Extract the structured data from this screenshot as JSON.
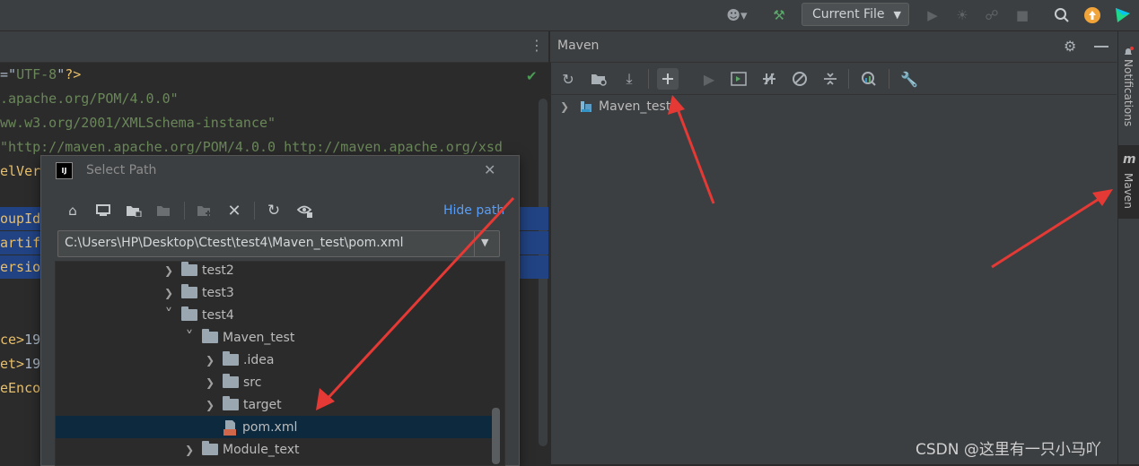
{
  "topbar": {
    "run_config": "Current File",
    "icons": [
      "user-icon",
      "hammer-icon",
      "run-icon",
      "debug-icon",
      "coverage-icon",
      "stop-icon",
      "search-icon",
      "update-icon",
      "jetbrains-logo-icon"
    ]
  },
  "editor": {
    "lines": [
      {
        "parts": [
          {
            "c": "w",
            "t": "=\""
          },
          {
            "c": "s",
            "t": "UTF-8"
          },
          {
            "c": "w",
            "t": "\""
          },
          {
            "c": "t",
            "t": "?>"
          }
        ]
      },
      {
        "parts": [
          {
            "c": "s",
            "t": ".apache.org/POM/4.0.0\""
          }
        ]
      },
      {
        "parts": [
          {
            "c": "s",
            "t": "ww.w3.org/2001/XMLSchema-instance\""
          }
        ]
      },
      {
        "parts": [
          {
            "c": "s",
            "t": "\"http://maven.apache.org/POM/4.0.0 http://maven.apache.org/xsd"
          }
        ]
      },
      {
        "parts": [
          {
            "c": "t",
            "t": "elVer"
          }
        ]
      },
      {
        "parts": []
      },
      {
        "parts": [
          {
            "c": "t",
            "t": "oupId"
          }
        ]
      },
      {
        "parts": [
          {
            "c": "t",
            "t": "artif"
          }
        ]
      },
      {
        "parts": [
          {
            "c": "t",
            "t": "ersio"
          }
        ]
      },
      {
        "parts": []
      },
      {
        "parts": []
      },
      {
        "parts": [
          {
            "c": "t",
            "t": "ce>"
          },
          {
            "c": "w",
            "t": "19"
          }
        ]
      },
      {
        "parts": [
          {
            "c": "t",
            "t": "et>"
          },
          {
            "c": "w",
            "t": "19"
          }
        ]
      },
      {
        "parts": [
          {
            "c": "t",
            "t": "eEnco"
          }
        ]
      }
    ]
  },
  "maven": {
    "title": "Maven",
    "project": "Maven_test",
    "toolbar_icons": [
      "reload-icon",
      "add-folder-icon",
      "download-icon",
      "add-icon",
      "run-icon",
      "execute-goal-icon",
      "toggle-offline-icon",
      "skip-tests-icon",
      "collapse-all-icon",
      "analyze-icon",
      "settings-wrench-icon"
    ]
  },
  "side_tabs": {
    "notifications": "Notifications",
    "maven": "Maven"
  },
  "dialog": {
    "title": "Select Path",
    "hide_path": "Hide path",
    "path": "C:\\Users\\HP\\Desktop\\Ctest\\test4\\Maven_test\\pom.xml",
    "tree": [
      {
        "label": "test2",
        "expanded": false,
        "level": 0,
        "type": "folder"
      },
      {
        "label": "test3",
        "expanded": false,
        "level": 0,
        "type": "folder"
      },
      {
        "label": "test4",
        "expanded": true,
        "level": 0,
        "type": "folder"
      },
      {
        "label": "Maven_test",
        "expanded": true,
        "level": 1,
        "type": "folder"
      },
      {
        "label": ".idea",
        "expanded": false,
        "level": 2,
        "type": "folder"
      },
      {
        "label": "src",
        "expanded": false,
        "level": 2,
        "type": "folder"
      },
      {
        "label": "target",
        "expanded": false,
        "level": 2,
        "type": "folder"
      },
      {
        "label": "pom.xml",
        "level": 2,
        "type": "file",
        "selected": true
      },
      {
        "label": "Module_text",
        "expanded": false,
        "level": 1,
        "type": "folder"
      }
    ]
  },
  "watermark": "CSDN @这里有一只小马吖"
}
